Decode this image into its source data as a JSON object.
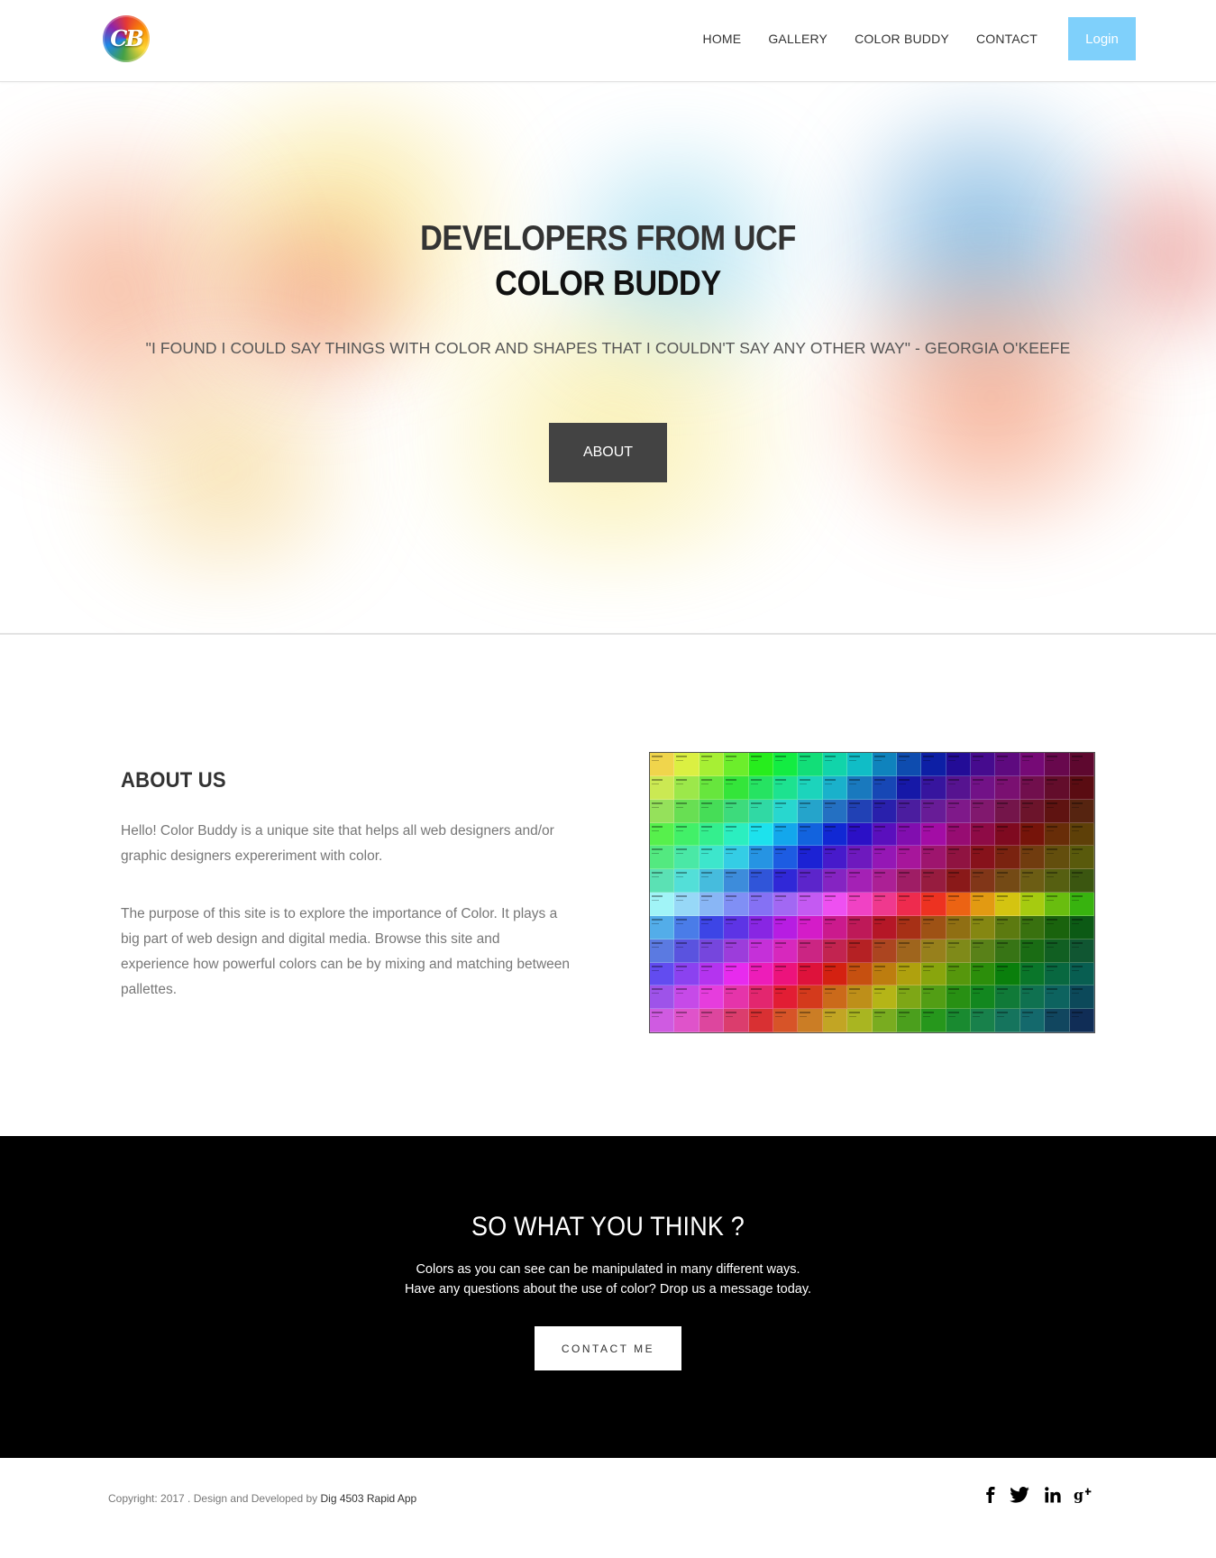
{
  "navbar": {
    "logo_text": "CB",
    "links": [
      "HOME",
      "GALLERY",
      "COLOR BUDDY",
      "CONTACT"
    ],
    "login_label": "Login",
    "login_color": "#7fd0fb"
  },
  "hero": {
    "title_line1": "DEVELOPERS FROM UCF",
    "title_line2": "COLOR BUDDY",
    "quote": "\"I FOUND I COULD SAY THINGS WITH COLOR AND SHAPES THAT I COULDN'T SAY ANY OTHER WAY\" - GEORGIA O'KEEFE",
    "about_button": "ABOUT"
  },
  "about": {
    "title": "ABOUT US",
    "paragraph1": "Hello! Color Buddy is a unique site that helps all web designers and/or graphic designers expereriment with color.",
    "paragraph2": "The purpose of this site is to explore the importance of Color. It plays a big part of web design and digital media. Browse this site and experience how powerful colors can be by mixing and matching between pallettes."
  },
  "cta": {
    "title": "SO WHAT YOU THINK ?",
    "line1": "Colors as you can see can be manipulated in many different ways.",
    "line2": "Have any questions about the use of color? Drop us a message today.",
    "button": "CONTACT ME"
  },
  "footer": {
    "copyright": "Copyright: 2017 . Design and Developed by ",
    "link_text": "Dig 4503 Rapid App",
    "social_icons": [
      "facebook-icon",
      "twitter-icon",
      "linkedin-icon",
      "google-plus-icon"
    ]
  }
}
